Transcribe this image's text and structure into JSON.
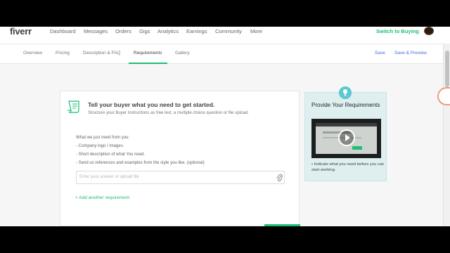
{
  "topnav": {
    "logo": "fiverr",
    "items": [
      "Dashboard",
      "Messages",
      "Orders",
      "Gigs",
      "Analytics",
      "Earnings",
      "Community",
      "More"
    ],
    "switch_label": "Switch to Buying"
  },
  "tabs": {
    "items": [
      "Overview",
      "Pricing",
      "Description & FAQ",
      "Requirements",
      "Gallery"
    ],
    "active": "Requirements",
    "save": "Save",
    "save_preview": "Save & Preview"
  },
  "card": {
    "title": "Tell your buyer what you need to get started.",
    "subtitle": "Structure your Buyer Instructions as free text, a multiple choice question or file upload.",
    "lines": [
      "What we just need from you:",
      "- Company logo / images.",
      "- Short description of what You need.",
      "- Send us references and examples from the style you like. (optional)"
    ],
    "input_placeholder": "Enter your answer or upload file",
    "add_requirement": "Add another requirement"
  },
  "tips": {
    "title": "Provide Your Requirements",
    "note": "Indicate what you need before you can start working."
  },
  "colors": {
    "accent_green": "#1dbf73",
    "link_blue": "#446ee7",
    "tips_bg": "#dfeff0"
  }
}
